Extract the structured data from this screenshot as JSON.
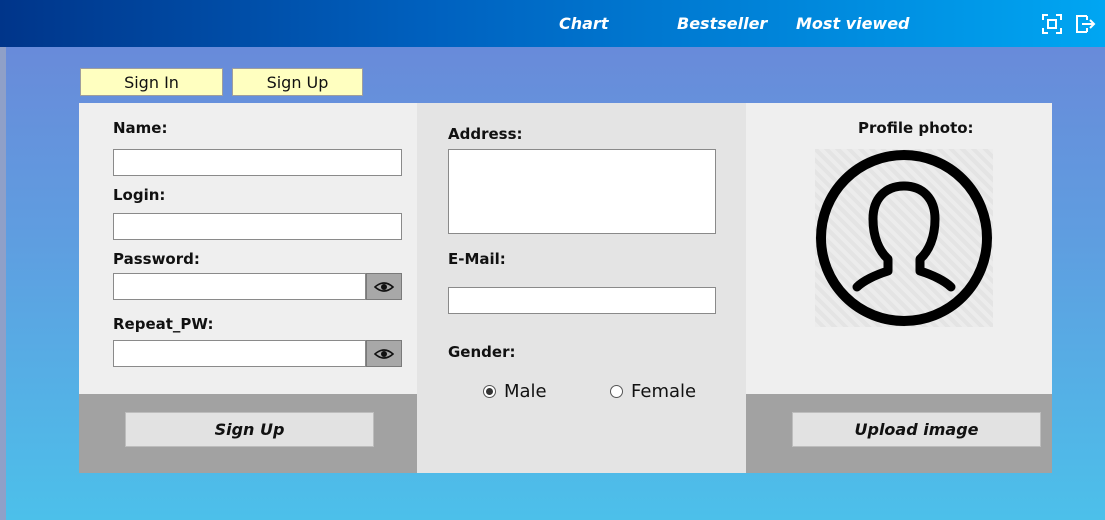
{
  "nav": {
    "links": [
      "Chart",
      "Bestseller",
      "Most viewed"
    ],
    "icons": [
      "fullscreen-icon",
      "logout-icon"
    ]
  },
  "tabs": {
    "sign_in": "Sign In",
    "sign_up": "Sign Up"
  },
  "form": {
    "name_label": "Name:",
    "login_label": "Login:",
    "password_label": "Password:",
    "repeat_pw_label": "Repeat_PW:",
    "address_label": "Address:",
    "email_label": "E-Mail:",
    "gender_label": "Gender:",
    "gender_options": [
      "Male",
      "Female"
    ],
    "gender_selected": "Male",
    "profile_photo_label": "Profile photo:",
    "signup_button": "Sign Up",
    "upload_button": "Upload image"
  }
}
